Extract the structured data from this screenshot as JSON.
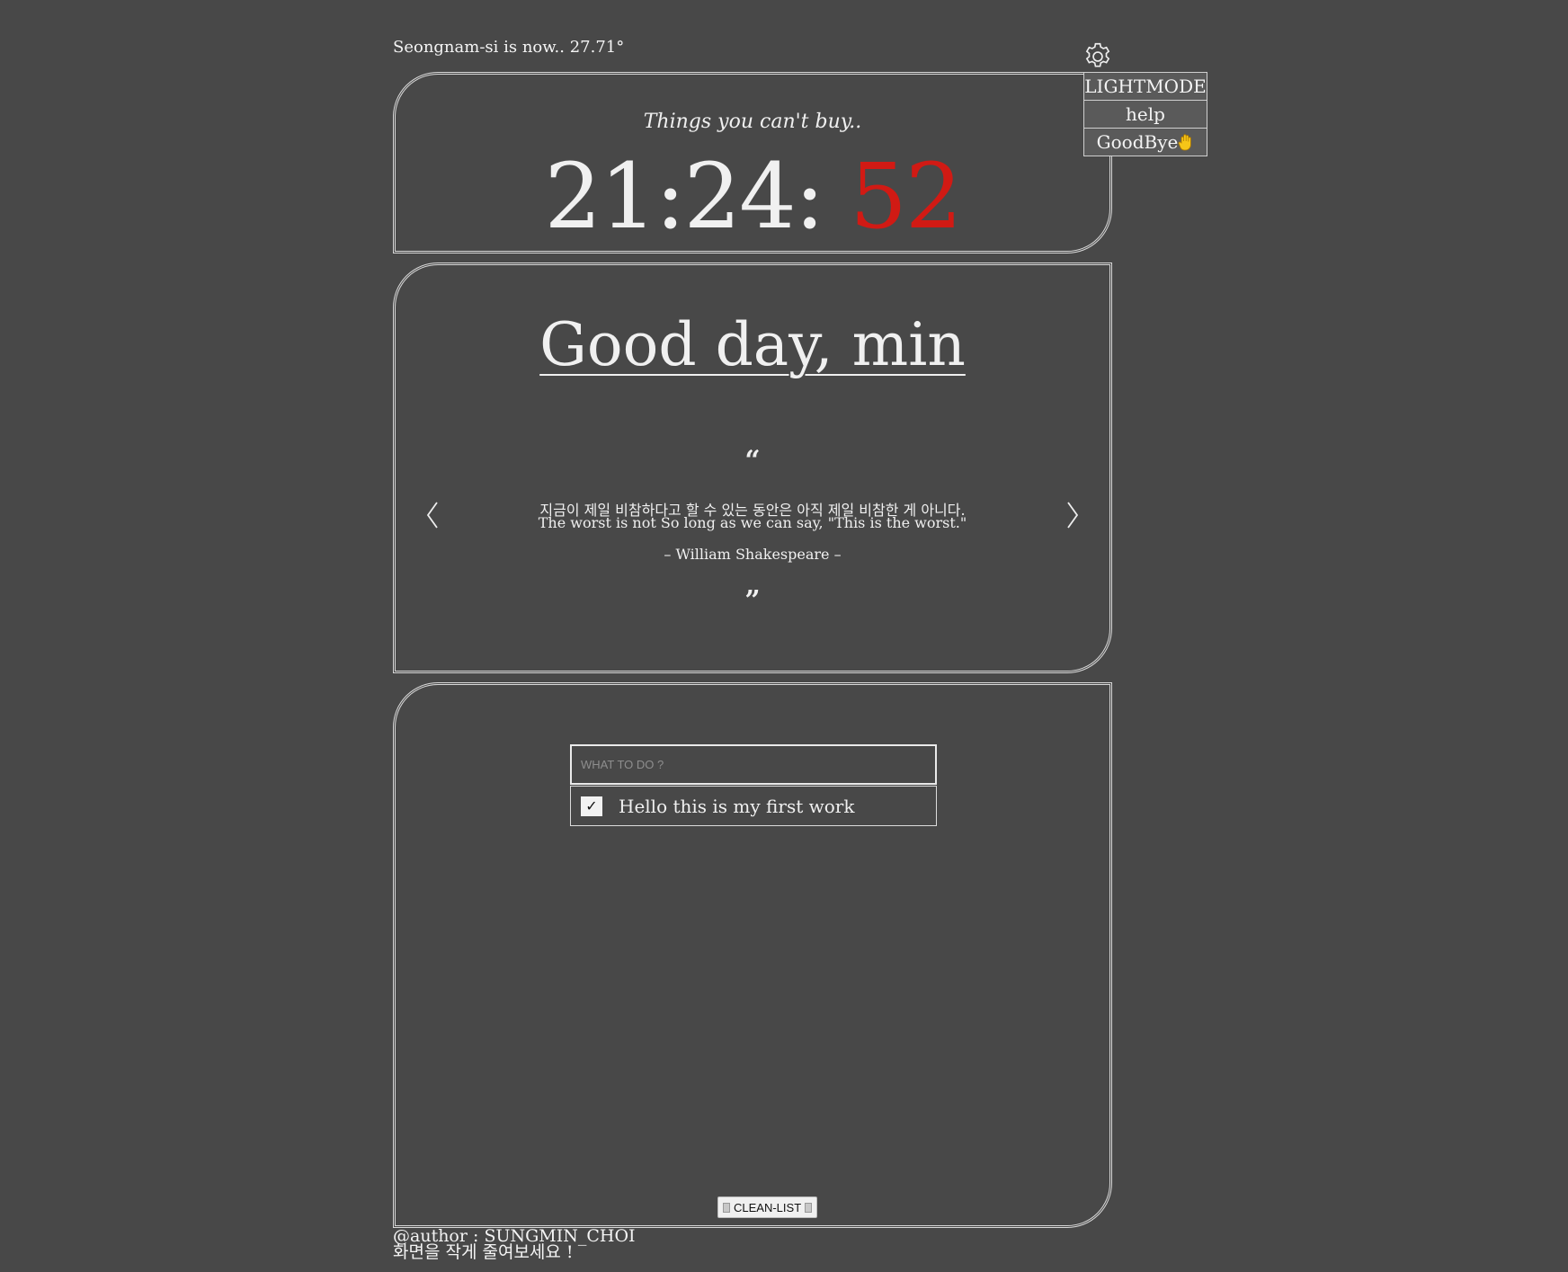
{
  "weather": {
    "text": "Seongnam-si is now.. 27.71°"
  },
  "settings": {
    "gear_icon": "gear-icon",
    "menu": [
      {
        "label": "LIGHTMODE"
      },
      {
        "label": "help"
      },
      {
        "label": "GoodBye",
        "icon": "waving-hand-icon"
      }
    ]
  },
  "clock": {
    "caption": "Things you can't buy..",
    "hours_minutes": "21:24: ",
    "seconds": "52",
    "seconds_color": "#d11a14"
  },
  "greeting": {
    "text": "Good day, min"
  },
  "quote": {
    "open_mark": "“",
    "korean": "지금이 제일 비참하다고 할 수 있는 동안은 아직 제일 비참한 게 아니다.",
    "english": "The worst is not So long as we can say, \"This is the worst.\"",
    "author": "– William Shakespeare –",
    "close_mark": "”"
  },
  "todo": {
    "placeholder": "WHAT TO DO ?",
    "items": [
      {
        "text": "Hello this is my first work",
        "checked": true,
        "check_glyph": "✓"
      }
    ],
    "clean_label": "CLEAN-LIST"
  },
  "footer": {
    "author": "@author : SUNGMIN_CHOI",
    "hint": "화면을 작게 줄여보세요 !"
  },
  "colors": {
    "background": "#484848",
    "text": "#f0f0f0",
    "accent": "#d11a14"
  }
}
